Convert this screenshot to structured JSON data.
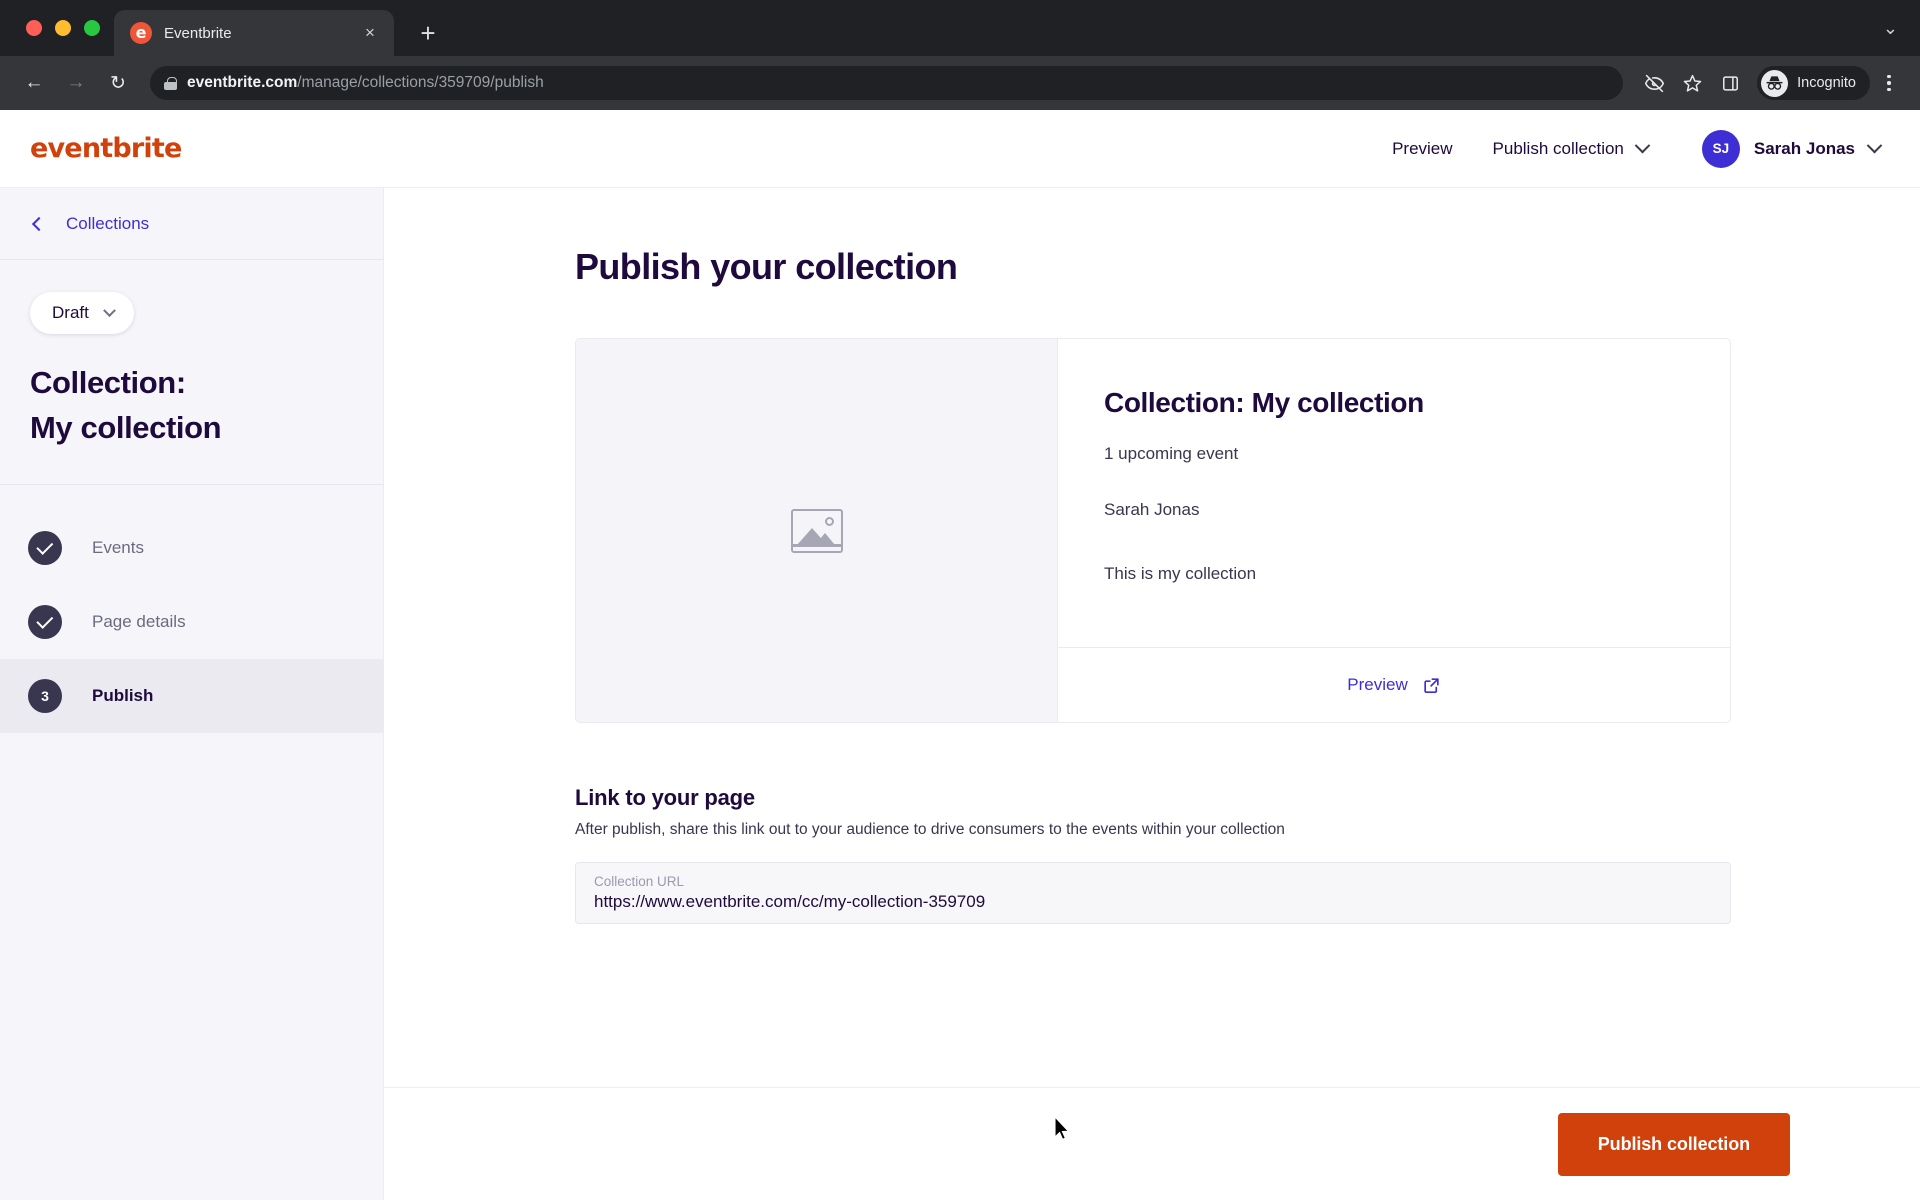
{
  "browser": {
    "tab": {
      "title": "Eventbrite",
      "favicon": "eventbrite-favicon",
      "close": "×"
    },
    "new_tab": "+",
    "tabstrip_chevron": "⌄",
    "nav": {
      "back": "←",
      "forward": "→",
      "reload": "↻"
    },
    "address": {
      "domain": "eventbrite.com",
      "path": "/manage/collections/359709/publish",
      "lock": "lock-icon"
    },
    "toolbar_icons": [
      "eye-off-icon",
      "star-icon",
      "side-panel-icon"
    ],
    "incognito_label": "Incognito",
    "menu": "kebab-menu-icon"
  },
  "header": {
    "logo": "eventbrite",
    "preview_label": "Preview",
    "publish_menu_label": "Publish collection",
    "user": {
      "initials": "SJ",
      "name": "Sarah Jonas"
    }
  },
  "sidebar": {
    "back_label": "Collections",
    "status_label": "Draft",
    "title_line1": "Collection:",
    "title_line2": "My collection",
    "steps": [
      {
        "badge": "✓",
        "label": "Events",
        "state": "complete"
      },
      {
        "badge": "✓",
        "label": "Page details",
        "state": "complete"
      },
      {
        "badge": "3",
        "label": "Publish",
        "state": "active"
      }
    ]
  },
  "main": {
    "page_title": "Publish your collection",
    "card": {
      "image_placeholder": "image-placeholder-icon",
      "title": "Collection: My collection",
      "upcoming": "1 upcoming event",
      "owner": "Sarah Jonas",
      "description": "This is my collection",
      "preview_label": "Preview"
    },
    "link_section": {
      "heading": "Link to your page",
      "description": "After publish, share this link out to your audience to drive consumers to the events within your collection",
      "field_label": "Collection URL",
      "field_value": "https://www.eventbrite.com/cc/my-collection-359709"
    },
    "footer": {
      "publish_button": "Publish collection"
    }
  },
  "colors": {
    "brand_orange": "#d1410c",
    "accent_blue": "#3d2fd4",
    "ink": "#1e0a3c",
    "sidebar_bg": "#f6f5fa"
  }
}
